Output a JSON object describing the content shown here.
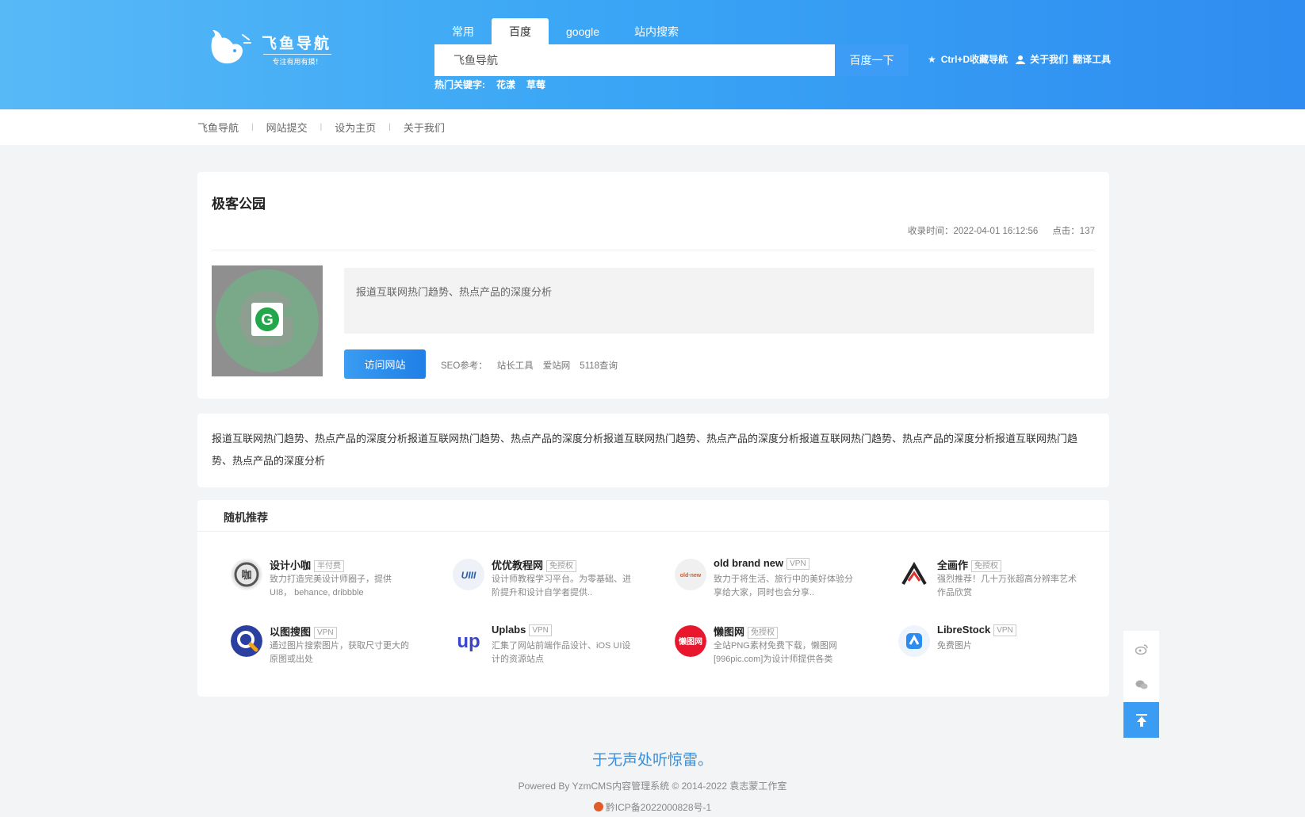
{
  "header": {
    "logo_title": "飞鱼导航",
    "logo_sub": "专注有用有摸！",
    "search_tabs": [
      "常用",
      "百度",
      "google",
      "站内搜索"
    ],
    "search_placeholder": "飞鱼导航",
    "search_button": "百度一下",
    "hot_label": "热门关键字:",
    "hot_keywords": [
      "花漾",
      "草莓"
    ],
    "top_links": [
      "Ctrl+D收藏导航",
      "关于我们",
      "翻译工具"
    ]
  },
  "nav": {
    "items": [
      "飞鱼导航",
      "网站提交",
      "设为主页",
      "关于我们"
    ]
  },
  "site": {
    "title": "极客公园",
    "time_label": "收录时间：2022-04-01 16:12:56",
    "clicks_label": "点击：137",
    "description": "报道互联网热门趋势、热点产品的深度分析",
    "visit_button": "访问网站",
    "seo_label": "SEO参考：",
    "seo_links": [
      "站长工具",
      "爱站网",
      "5118查询"
    ]
  },
  "content": {
    "body": "报道互联网热门趋势、热点产品的深度分析报道互联网热门趋势、热点产品的深度分析报道互联网热门趋势、热点产品的深度分析报道互联网热门趋势、热点产品的深度分析报道互联网热门趋势、热点产品的深度分析"
  },
  "recommend": {
    "title": "随机推荐",
    "items": [
      {
        "name": "设计小咖",
        "tag": "半付费",
        "desc": "致力打造完美设计师圈子，提供UI8， behance, dribbble"
      },
      {
        "name": "优优教程网",
        "tag": "免授权",
        "desc": "设计师教程学习平台。为零基础、进阶提升和设计自学者提供.."
      },
      {
        "name": "old brand new",
        "tag": "VPN",
        "desc": "致力于将生活、旅行中的美好体验分享给大家，同时也会分享.."
      },
      {
        "name": "全画作",
        "tag": "免授权",
        "desc": "强烈推荐！几十万张超高分辨率艺术作品欣赏"
      },
      {
        "name": "以图搜图",
        "tag": "VPN",
        "desc": "通过图片搜索图片，获取尺寸更大的原图或出处"
      },
      {
        "name": "Uplabs",
        "tag": "VPN",
        "desc": "汇集了网站前端作品设计、iOS UI设计的资源站点"
      },
      {
        "name": "懒图网",
        "tag": "免授权",
        "desc": "全站PNG素材免费下载，懒图网[996pic.com]为设计师提供各类"
      },
      {
        "name": "LibreStock",
        "tag": "VPN",
        "desc": "免费图片"
      }
    ]
  },
  "footer": {
    "quote": "于无声处听惊雷。",
    "copyright": "Powered By YzmCMS内容管理系统 © 2014-2022 袁志蒙工作室",
    "icp": "黔ICP备2022000828号-1"
  },
  "colors": {
    "brand": "#3aa6f5",
    "accent_button": "#1f7fe6",
    "footer_quote": "#3a8fd8"
  }
}
